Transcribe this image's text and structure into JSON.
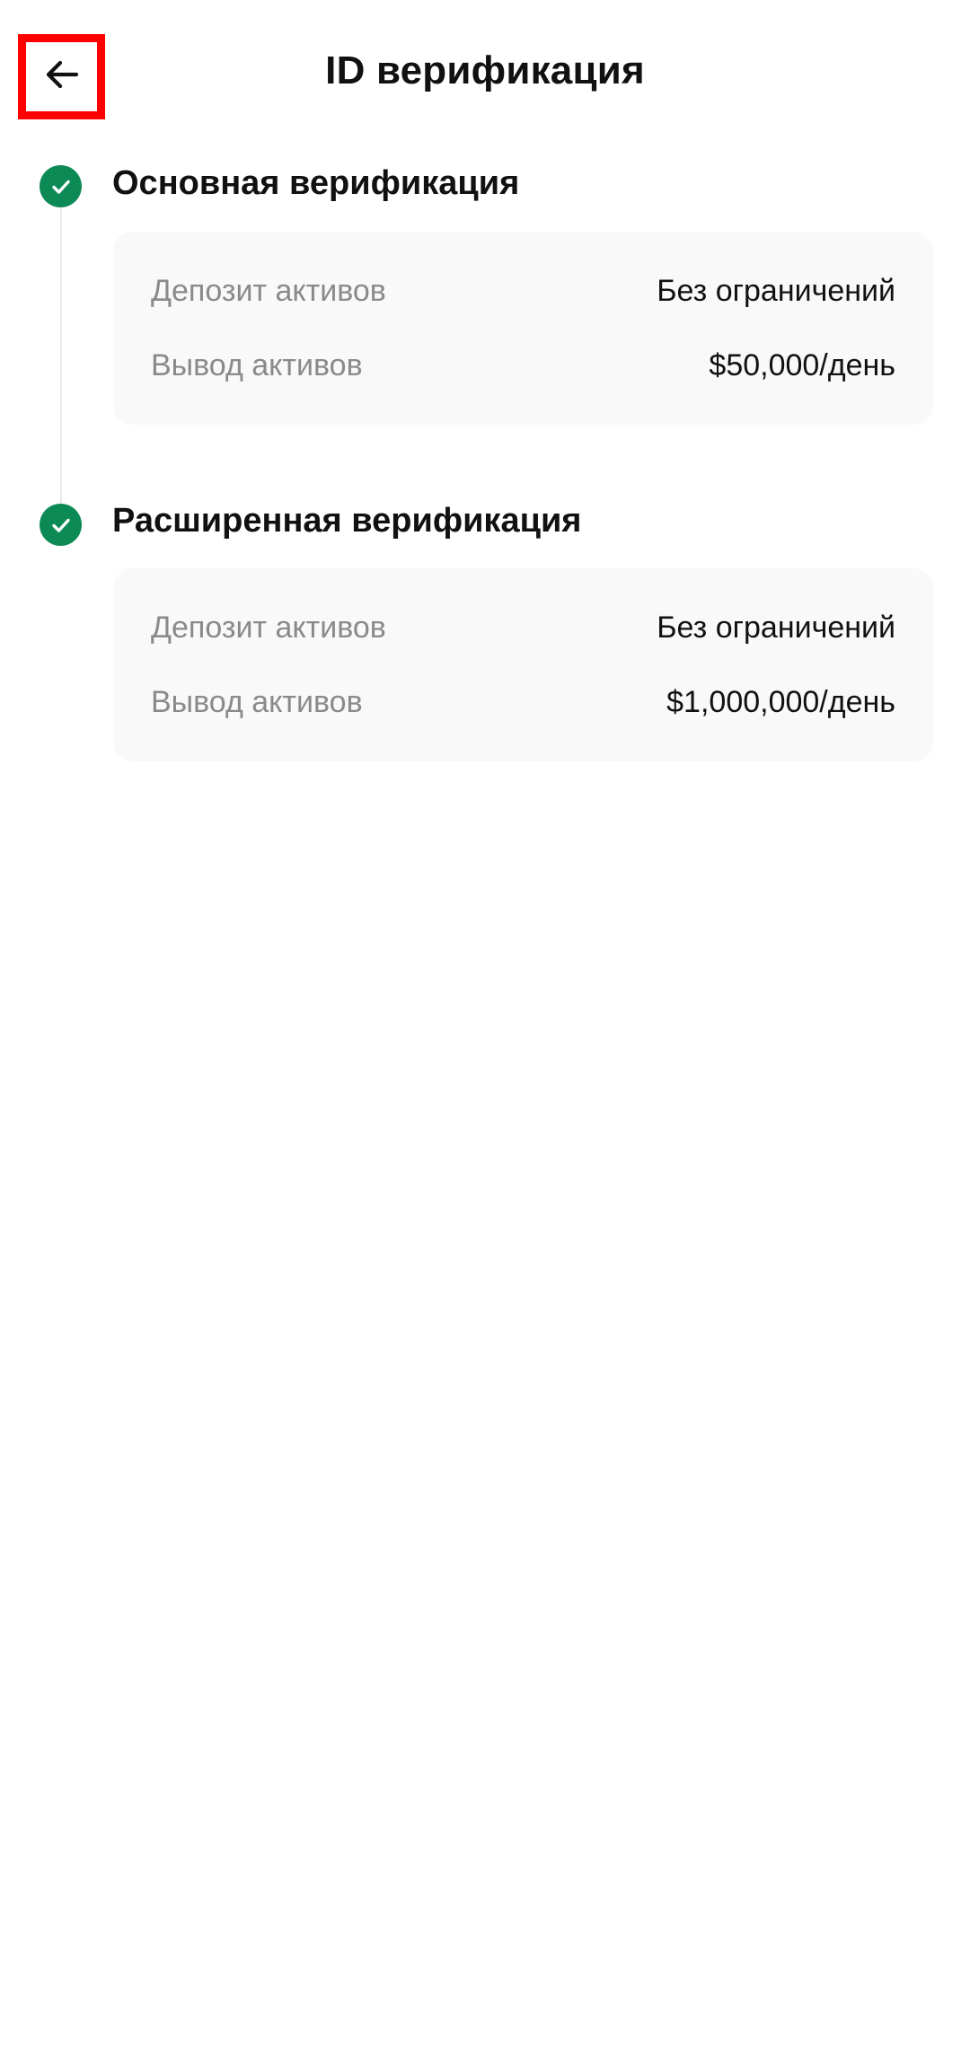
{
  "header": {
    "title": "ID верификация",
    "back_icon": "arrow-left-icon"
  },
  "levels": [
    {
      "title": "Основная верификация",
      "status_icon": "check-circle-icon",
      "status_color": "#0c8a55",
      "rows": [
        {
          "label": "Депозит активов",
          "value": "Без ограничений"
        },
        {
          "label": "Вывод активов",
          "value": "$50,000/день"
        }
      ]
    },
    {
      "title": "Расширенная верификация",
      "status_icon": "check-circle-icon",
      "status_color": "#0c8a55",
      "rows": [
        {
          "label": "Депозит активов",
          "value": "Без ограничений"
        },
        {
          "label": "Вывод активов",
          "value": "$1,000,000/день"
        }
      ]
    }
  ],
  "colors": {
    "highlight_border": "#ff0000",
    "card_background": "#f9f9f9",
    "label_text": "#8a8a8a"
  }
}
